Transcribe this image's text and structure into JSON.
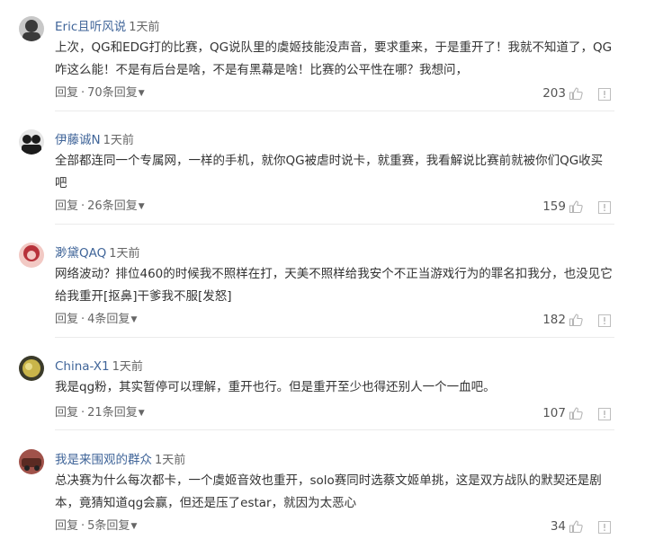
{
  "comments": [
    {
      "username": "Eric且听风说",
      "time": "1天前",
      "text": "上次，QG和EDG打的比赛，QG说队里的虞姬技能没声音，要求重来，于是重开了！我就不知道了，QG咋这么能！不是有后台是啥，不是有黑幕是啥！比赛的公平性在哪？我想问，",
      "reply_label": "回复",
      "sep": "·",
      "replies_label": "70条回复",
      "likes": "203",
      "avatar_colors": [
        "#3a3a3a",
        "#c8c8c8"
      ]
    },
    {
      "username": "伊藤诚N",
      "time": "1天前",
      "text": "全部都连同一个专属网，一样的手机，就你QG被虐时说卡，就重赛，我看解说比赛前就被你们QG收买吧",
      "reply_label": "回复",
      "sep": "·",
      "replies_label": "26条回复",
      "likes": "159",
      "avatar_colors": [
        "#1b1b1b",
        "#e6e6e6"
      ]
    },
    {
      "username": "渺黛QAQ",
      "time": "1天前",
      "text": "网络波动？排位460的时候我不照样在打，天美不照样给我安个不正当游戏行为的罪名扣我分，也没见它给我重开[抠鼻]干爹我不服[发怒]",
      "reply_label": "回复",
      "sep": "·",
      "replies_label": "4条回复",
      "likes": "182",
      "avatar_colors": [
        "#b7323a",
        "#f2c9c4"
      ]
    },
    {
      "username": "China-X1",
      "time": "1天前",
      "text": "我是qg粉，其实暂停可以理解，重开也行。但是重开至少也得还别人一个一血吧。",
      "reply_label": "回复",
      "sep": "·",
      "replies_label": "21条回复",
      "likes": "107",
      "avatar_colors": [
        "#c9b54a",
        "#3b3b2a"
      ]
    },
    {
      "username": "我是来围观的群众",
      "time": "1天前",
      "text": "总决赛为什么每次都卡，一个虞姬音效也重开，solo赛同时选蔡文姬单挑，这是双方战队的默契还是剧本，竟猜知道qg会赢，但还是压了estar，就因为太恶心",
      "reply_label": "回复",
      "sep": "·",
      "replies_label": "5条回复",
      "likes": "34",
      "avatar_colors": [
        "#5a2a22",
        "#a0524a"
      ]
    }
  ]
}
